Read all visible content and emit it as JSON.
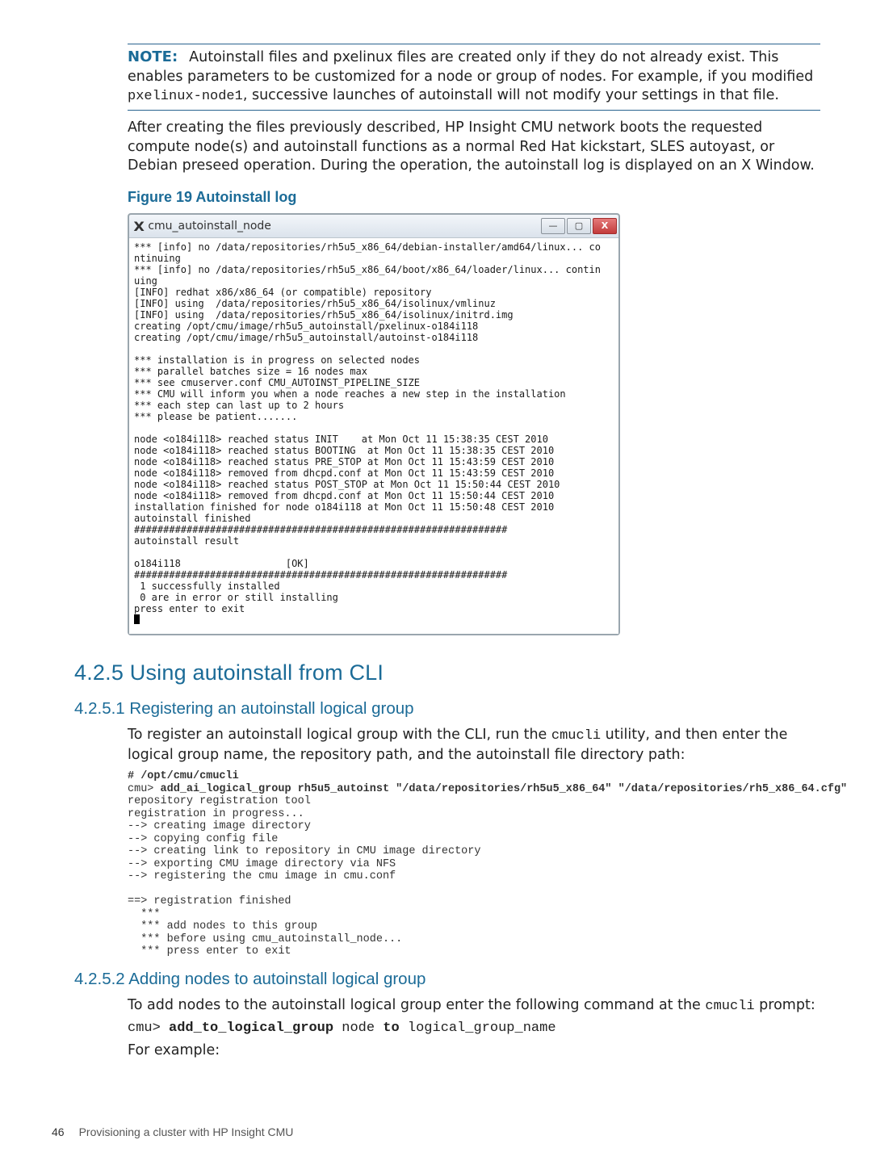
{
  "note": {
    "label": "NOTE:",
    "text_before": "Autoinstall files and pxelinux files are created only if they do not already exist. This enables parameters to be customized for a node or group of nodes. For example, if you modified ",
    "code": "pxelinux-node1",
    "text_after": ", successive launches of autoinstall will not modify your settings in that file."
  },
  "post_note": "After creating the files previously described, HP Insight CMU network boots the requested compute node(s) and autoinstall functions as a normal Red Hat kickstart, SLES autoyast, or Debian preseed operation. During the operation, the autoinstall log is displayed on an X Window.",
  "figure_caption": "Figure 19 Autoinstall log",
  "term": {
    "title": "cmu_autoinstall_node",
    "min_glyph": "—",
    "max_glyph": "▢",
    "close_glyph": "X",
    "body": "*** [info] no /data/repositories/rh5u5_x86_64/debian-installer/amd64/linux... co\nntinuing\n*** [info] no /data/repositories/rh5u5_x86_64/boot/x86_64/loader/linux... contin\nuing\n[INFO] redhat x86/x86_64 (or compatible) repository\n[INFO] using  /data/repositories/rh5u5_x86_64/isolinux/vmlinuz\n[INFO] using  /data/repositories/rh5u5_x86_64/isolinux/initrd.img\ncreating /opt/cmu/image/rh5u5_autoinstall/pxelinux-o184i118\ncreating /opt/cmu/image/rh5u5_autoinstall/autoinst-o184i118\n\n*** installation is in progress on selected nodes\n*** parallel batches size = 16 nodes max\n*** see cmuserver.conf CMU_AUTOINST_PIPELINE_SIZE\n*** CMU will inform you when a node reaches a new step in the installation\n*** each step can last up to 2 hours\n*** please be patient.......\n\nnode <o184i118> reached status INIT    at Mon Oct 11 15:38:35 CEST 2010\nnode <o184i118> reached status BOOTING  at Mon Oct 11 15:38:35 CEST 2010\nnode <o184i118> reached status PRE_STOP at Mon Oct 11 15:43:59 CEST 2010\nnode <o184i118> removed from dhcpd.conf at Mon Oct 11 15:43:59 CEST 2010\nnode <o184i118> reached status POST_STOP at Mon Oct 11 15:50:44 CEST 2010\nnode <o184i118> removed from dhcpd.conf at Mon Oct 11 15:50:44 CEST 2010\ninstallation finished for node o184i118 at Mon Oct 11 15:50:48 CEST 2010\nautoinstall finished\n################################################################\nautoinstall result\n\no184i118                  [OK]\n################################################################\n 1 successfully installed\n 0 are in error or still installing\npress enter to exit"
  },
  "s425": {
    "heading": "4.2.5 Using autoinstall from CLI"
  },
  "s4251": {
    "heading": "4.2.5.1 Registering an autoinstall logical group",
    "intro_a": "To register an autoinstall logical group with the CLI, run the ",
    "intro_code": "cmucli",
    "intro_b": " utility, and then enter the logical group name, the repository path, and the autoinstall file directory path:",
    "cli": {
      "l1": "# /opt/cmu/cmucli",
      "l2a": "cmu> ",
      "l2b": "add_ai_logical_group rh5u5_autoinst \"/data/repositories/rh5u5_x86_64\" \"/data/repositories/rh5_x86_64.cfg\"",
      "body": "\nrepository registration tool\nregistration in progress...\n--> creating image directory\n--> copying config file\n--> creating link to repository in CMU image directory\n--> exporting CMU image directory via NFS\n--> registering the cmu image in cmu.conf\n\n==> registration finished\n  ***\n  *** add nodes to this group\n  *** before using cmu_autoinstall_node...\n  *** press enter to exit"
    }
  },
  "s4252": {
    "heading": "4.2.5.2 Adding nodes to autoinstall logical group",
    "intro_a": "To add nodes to the autoinstall logical group enter the following command at the ",
    "intro_code": "cmucli",
    "intro_b": " prompt:",
    "cmd": {
      "p1": "cmu> ",
      "b1": "add_to_logical_group",
      "p2": " node ",
      "b2": "to",
      "p3": " logical_group_name"
    },
    "for_example": "For example:"
  },
  "footer": {
    "page": "46",
    "title": "Provisioning a cluster with HP Insight CMU"
  }
}
